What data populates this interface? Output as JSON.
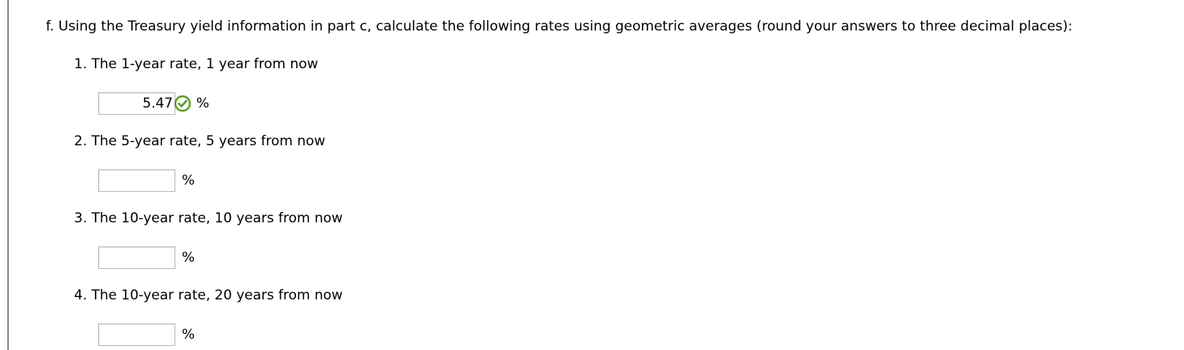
{
  "question": {
    "text": "f.  Using the Treasury yield information in part c, calculate the following rates using geometric averages (round your answers to three decimal places):"
  },
  "items": [
    {
      "label": "1.  The 1-year rate, 1 year from now",
      "value": "5.47",
      "unit": "%",
      "status": "correct"
    },
    {
      "label": "2.  The 5-year rate, 5 years from now",
      "value": "",
      "unit": "%"
    },
    {
      "label": "3.  The 10-year rate, 10 years from now",
      "value": "",
      "unit": "%"
    },
    {
      "label": "4.  The 10-year rate, 20 years from now",
      "value": "",
      "unit": "%"
    }
  ],
  "colors": {
    "check_green": "#5a9e2f",
    "input_border": "#b9b9b9"
  },
  "icons": {
    "correct": "checkmark-circle-icon"
  }
}
